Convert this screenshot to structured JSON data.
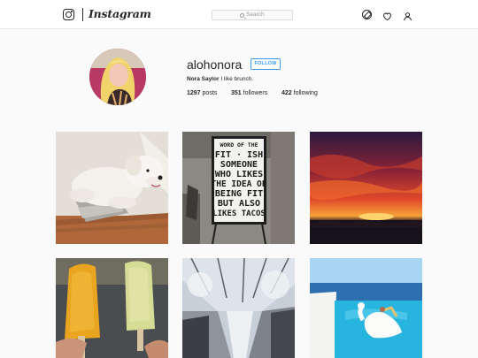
{
  "header": {
    "wordmark": "Instagram",
    "search_placeholder": "Search",
    "icons": [
      "instagram-glyph-icon",
      "compass-icon",
      "heart-icon",
      "person-icon"
    ]
  },
  "profile": {
    "username": "alohonora",
    "follow_label": "FOLLOW",
    "full_name": "Nora Saylor",
    "bio": "I like brunch.",
    "posts_count": "1297",
    "posts_label": "posts",
    "followers_count": "351",
    "followers_label": "followers",
    "following_count": "422",
    "following_label": "following"
  },
  "grid": {
    "sign_lines": [
      "WORD OF THE",
      "FIT · ISH",
      "SOMEONE",
      "WHO LIKES",
      "THE IDEA OF",
      "BEING FIT",
      "BUT ALSO",
      "LIKES TACOS"
    ]
  },
  "colors": {
    "accent": "#3897f0",
    "text": "#262626",
    "background": "#fafafa",
    "border": "#dbdbdb"
  }
}
